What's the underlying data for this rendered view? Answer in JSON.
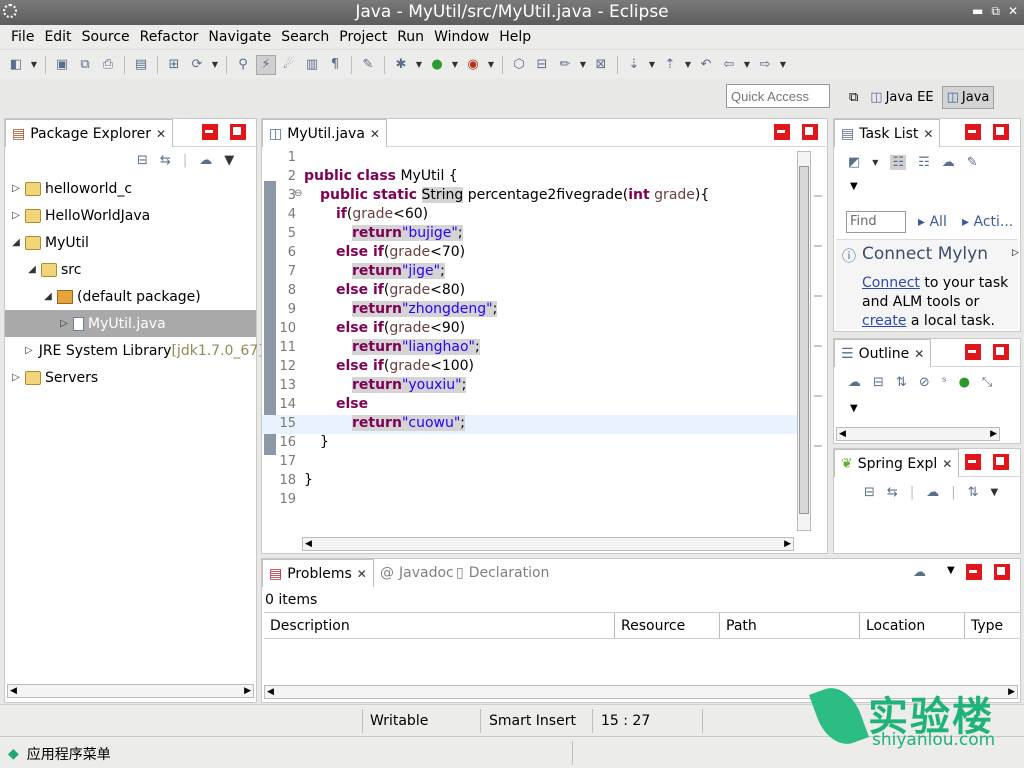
{
  "window": {
    "title": "Java - MyUtil/src/MyUtil.java - Eclipse",
    "buttons": [
      "▬",
      "⧉",
      "✕"
    ]
  },
  "menu": [
    "File",
    "Edit",
    "Source",
    "Refactor",
    "Navigate",
    "Search",
    "Project",
    "Run",
    "Window",
    "Help"
  ],
  "quick_access": {
    "placeholder": "Quick Access"
  },
  "perspectives": [
    {
      "label": "Java EE",
      "active": false
    },
    {
      "label": "Java",
      "active": true
    }
  ],
  "package_explorer": {
    "tab": "Package Explorer",
    "tree": [
      {
        "label": "helloworld_c",
        "depth": 0,
        "twisty": "▷",
        "icon": "folder"
      },
      {
        "label": "HelloWorldJava",
        "depth": 0,
        "twisty": "▷",
        "icon": "folder"
      },
      {
        "label": "MyUtil",
        "depth": 0,
        "twisty": "◢",
        "icon": "folder"
      },
      {
        "label": "src",
        "depth": 1,
        "twisty": "◢",
        "icon": "folder"
      },
      {
        "label": "(default package)",
        "depth": 2,
        "twisty": "◢",
        "icon": "package"
      },
      {
        "label": "MyUtil.java",
        "depth": 3,
        "twisty": "▷",
        "icon": "java-file",
        "selected": true
      },
      {
        "label": "JRE System Library",
        "suffix": " [jdk1.7.0_67]",
        "depth": 1,
        "twisty": "▷",
        "icon": "library"
      },
      {
        "label": "Servers",
        "depth": 0,
        "twisty": "▷",
        "icon": "folder"
      }
    ]
  },
  "editor": {
    "tab": "MyUtil.java",
    "line_numbers": [
      "1",
      "2",
      "3",
      "4",
      "5",
      "6",
      "7",
      "8",
      "9",
      "10",
      "11",
      "12",
      "13",
      "14",
      "15",
      "16",
      "17",
      "18",
      "19"
    ],
    "code": {
      "l2_kw": "public class",
      "l2_rest": " MyUtil {",
      "l3_kw": "public static",
      "l3_type": "String",
      "l3_name": " percentage2fivegrade(",
      "l3_kw2": "int",
      "l3_param": "grade",
      "l3_end": "){",
      "if_kw": "if",
      "else_kw": "else",
      "else_if_kw": "else if",
      "return_kw": "return",
      "var": "grade",
      "c60": "<60)",
      "c70": "<70)",
      "c80": "<80)",
      "c90": "<90)",
      "c100": "<100)",
      "s1": "\"bujige\"",
      "s2": "\"jige\"",
      "s3": "\"zhongdeng\"",
      "s4": "\"lianghao\"",
      "s5": "\"youxiu\"",
      "s6": "\"cuowu\"",
      "semi": ";",
      "lp": "(",
      "brace": "}"
    }
  },
  "task_list": {
    "tab": "Task List",
    "find_placeholder": "Find",
    "filter_all": "All",
    "filter_activate": "Acti...",
    "mylyn_title": "Connect Mylyn",
    "mylyn_connect": "Connect",
    "mylyn_text1": " to your task and ALM tools or ",
    "mylyn_create": "create",
    "mylyn_text2": " a local task."
  },
  "outline": {
    "tab": "Outline"
  },
  "spring": {
    "tab": "Spring Expl"
  },
  "problems": {
    "tabs": [
      "Problems",
      "Javadoc",
      "Declaration"
    ],
    "count": "0 items",
    "columns": [
      "Description",
      "Resource",
      "Path",
      "Location",
      "Type"
    ]
  },
  "status": {
    "writable": "Writable",
    "insert_mode": "Smart Insert",
    "position": "15 : 27"
  },
  "taskbar": {
    "start": "应用程序菜单"
  },
  "watermark": {
    "brand": "实验楼",
    "domain": "shiyanlou.com"
  }
}
